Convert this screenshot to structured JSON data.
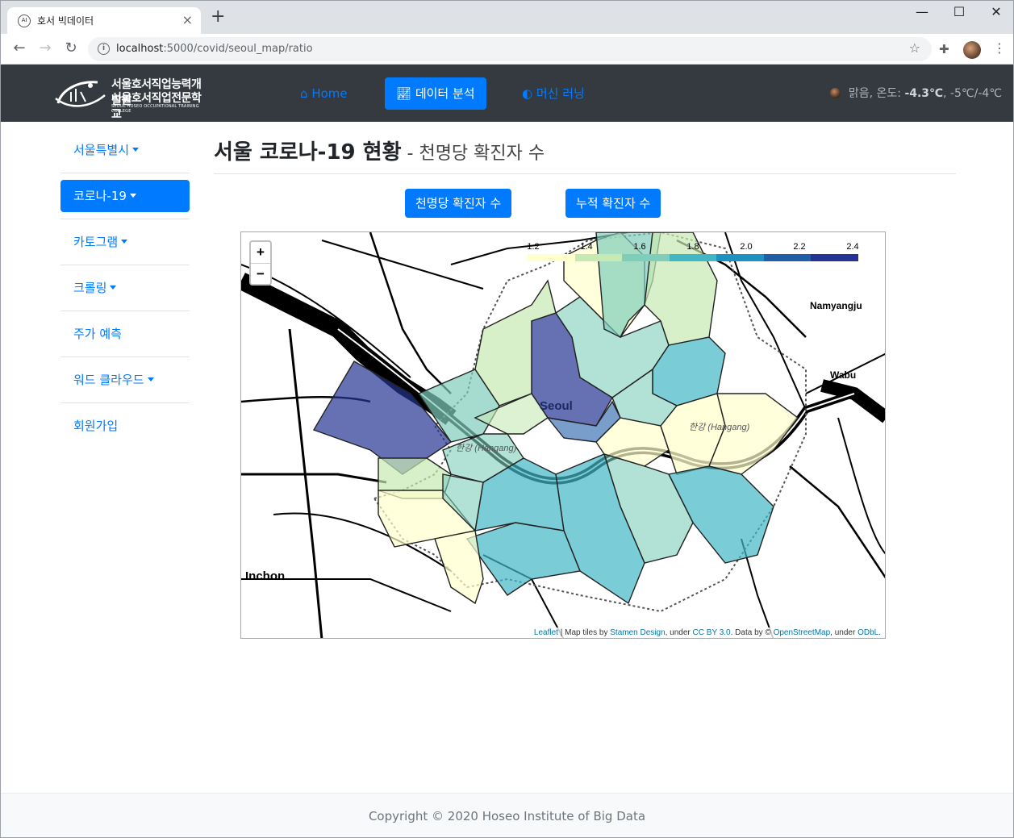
{
  "browser": {
    "tab_title": "호서 빅데이터",
    "favicon_text": "AI",
    "tab_close": "×",
    "new_tab": "+",
    "window_controls": [
      "—",
      "☐",
      "✕"
    ],
    "url_host": "localhost",
    "url_rest": ":5000/covid/seoul_map/ratio"
  },
  "navbar": {
    "logo_line1": "서울호서직업능력개발원",
    "logo_line2": "서울호서직업전문학교",
    "logo_line3": "SEOUL HOSEO OCCUPATIONAL TRAINING COLLEGE",
    "links": [
      {
        "label": "Home",
        "icon": "home-icon"
      },
      {
        "label": "데이터 분석",
        "icon": "chart-line-icon",
        "active": true
      },
      {
        "label": "머신 러닝",
        "icon": "brain-icon"
      }
    ],
    "weather_prefix": "맑음, 온도: ",
    "weather_temp": "-4.3℃",
    "weather_range": ", -5℃/-4℃"
  },
  "sidebar": {
    "items": [
      {
        "label": "서울특별시",
        "dropdown": true
      },
      {
        "label": "코로나-19",
        "dropdown": true,
        "active": true
      },
      {
        "label": "카토그램",
        "dropdown": true
      },
      {
        "label": "크롤링",
        "dropdown": true
      },
      {
        "label": "주가 예측",
        "dropdown": false
      },
      {
        "label": "워드 클라우드",
        "dropdown": true
      },
      {
        "label": "회원가입",
        "dropdown": false
      }
    ]
  },
  "main": {
    "title": "서울 코로나-19 현황",
    "subtitle": " - 천명당 확진자 수",
    "buttons": [
      "천명당 확진자 수",
      "누적 확진자 수"
    ]
  },
  "map": {
    "zoom_in": "+",
    "zoom_out": "−",
    "legend_ticks": [
      "1.2",
      "1.4",
      "1.6",
      "1.8",
      "2.0",
      "2.2",
      "2.4"
    ],
    "legend_colors": [
      "#ffffcc",
      "#c7e9b4",
      "#7fcdbb",
      "#41b6c4",
      "#1d91c0",
      "#225ea8",
      "#253494"
    ],
    "labels": {
      "seoul": "Seoul",
      "inchon": "Inchon",
      "namyangju": "Namyangju",
      "wabu": "Wabu",
      "hangang_east": "한강 (Hangang)",
      "hangang_west": "한강 (Hangang)"
    },
    "attribution": {
      "leaflet": "Leaflet",
      "sep1": " | Map tiles by ",
      "stamen": "Stamen Design",
      "sep2": ", under ",
      "ccby": "CC BY 3.0",
      "sep3": ". Data by © ",
      "osm": "OpenStreetMap",
      "sep4": ", under ",
      "odbl": "ODbL",
      "end": "."
    }
  },
  "footer": {
    "copyright": "Copyright © 2020 Hoseo Institute of Big Data"
  }
}
